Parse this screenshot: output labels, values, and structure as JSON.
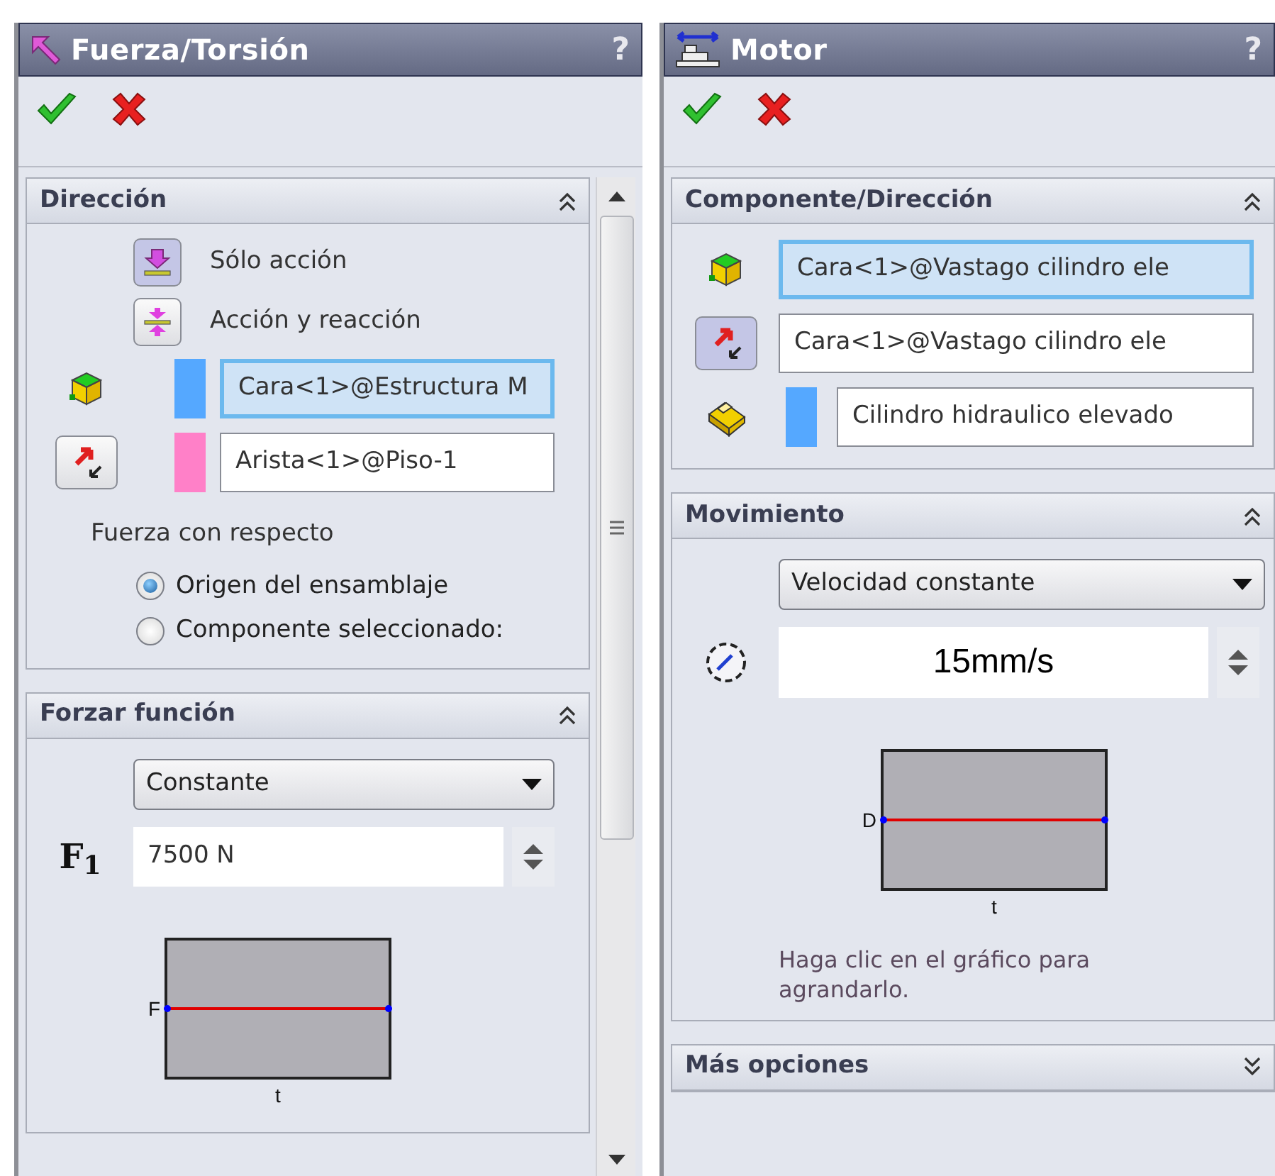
{
  "panels": [
    {
      "kind": "force",
      "title": "Fuerza/Torsión",
      "help": "?",
      "scrollbar": true,
      "sections": [
        {
          "title": "Dirección",
          "expanded": true,
          "items": [
            {
              "kind": "action",
              "label": "Sólo acción",
              "selected": true
            },
            {
              "kind": "reaction",
              "label": "Acción y reacción",
              "selected": false
            },
            {
              "kind": "face",
              "color": "#55a8ff",
              "value": "Cara<1>@Estructura M",
              "focused": true
            },
            {
              "kind": "direction",
              "color": "#ff80c8",
              "value": "Arista<1>@Piso-1",
              "focused": false,
              "pressed": false
            },
            {
              "kind": "label",
              "text": "Fuerza con respecto"
            },
            {
              "kind": "radio",
              "label": "Origen del ensamblaje",
              "selected": true
            },
            {
              "kind": "radio",
              "label": "Componente seleccionado:",
              "selected": false
            }
          ]
        },
        {
          "title": "Forzar función",
          "expanded": true,
          "items": [
            {
              "kind": "dropdown",
              "value": "Constante"
            },
            {
              "kind": "spin",
              "symbol": "F$_{1}$",
              "value": "7500 N"
            },
            {
              "kind": "graph",
              "ylabel": "F",
              "xlabel": "t"
            }
          ]
        }
      ]
    },
    {
      "kind": "motor",
      "title": "Motor",
      "help": "?",
      "sections": [
        {
          "title": "Componente/Dirección",
          "expanded": true,
          "items": [
            {
              "kind": "face",
              "value": "Cara<1>@Vastago cilindro ele",
              "focused": true
            },
            {
              "kind": "direction",
              "value": "Cara<1>@Vastago cilindro ele",
              "focused": false,
              "pressed": true
            },
            {
              "kind": "component",
              "color": "#55a8ff",
              "value": "Cilindro hidraulico elevado",
              "focused": false
            }
          ]
        },
        {
          "title": "Movimiento",
          "expanded": true,
          "items": [
            {
              "kind": "dropdown",
              "value": "Velocidad constante"
            },
            {
              "kind": "speed",
              "value": "15mm/s"
            },
            {
              "kind": "graph",
              "ylabel": "D",
              "xlabel": "t"
            },
            {
              "kind": "note",
              "text": "Haga clic en el gráfico para agrandarlo."
            }
          ]
        },
        {
          "title": "Más opciones",
          "expanded": false
        }
      ]
    }
  ]
}
